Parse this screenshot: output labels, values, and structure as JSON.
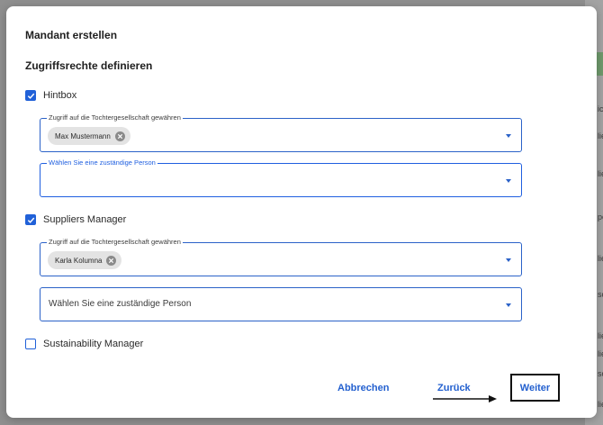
{
  "background_fragments": [
    "ic",
    "lie",
    "lie",
    "po",
    "lie",
    "so",
    "lie",
    "lie",
    "so",
    "lie"
  ],
  "dialog": {
    "title": "Mandant erstellen",
    "section_title": "Zugriffsrechte definieren",
    "groups": [
      {
        "label": "Hintbox",
        "checked": true,
        "access_field": {
          "label": "Zugriff auf die Tochtergesellschaft gewähren",
          "chip": "Max Mustermann"
        },
        "person_field": {
          "label": "Wählen Sie eine zuständige Person",
          "value": "",
          "focused": true
        }
      },
      {
        "label": "Suppliers Manager",
        "checked": true,
        "access_field": {
          "label": "Zugriff auf die Tochtergesellschaft gewähren",
          "chip": "Karla Kolumna"
        },
        "person_field": {
          "placeholder": "Wählen Sie eine zuständige Person"
        }
      },
      {
        "label": "Sustainability Manager",
        "checked": false
      }
    ],
    "buttons": {
      "cancel": "Abbrechen",
      "back": "Zurück",
      "next": "Weiter"
    }
  },
  "colors": {
    "accent": "#2161d8",
    "link": "#2360cf",
    "overlay": "#8f8f8f"
  },
  "icons": {
    "checkbox_checked": "check-icon",
    "chip_remove": "close-icon",
    "dropdown": "chevron-down-icon",
    "annotation": "arrow-right-icon"
  }
}
